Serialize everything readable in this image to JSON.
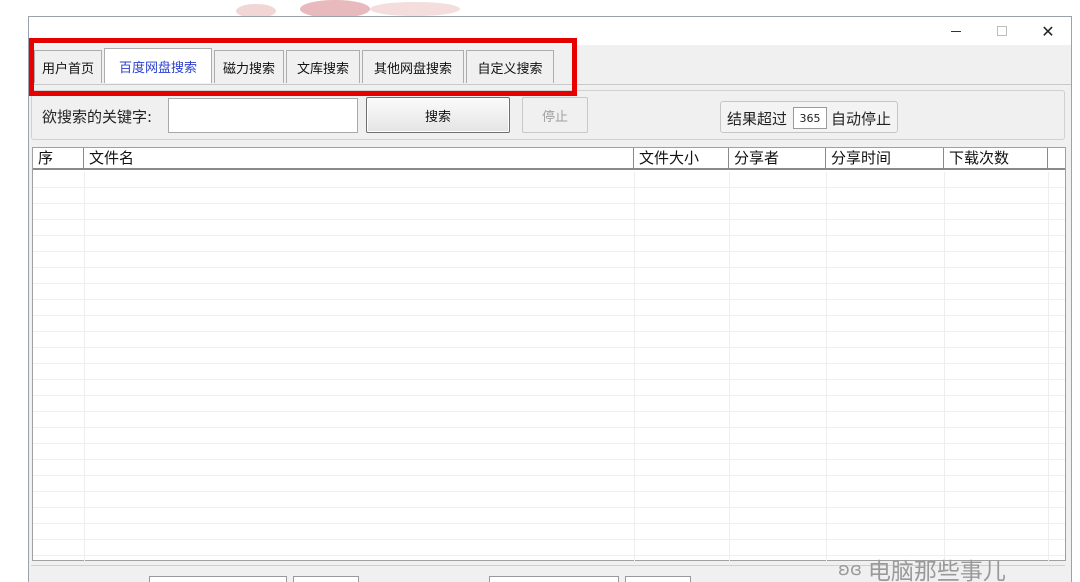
{
  "window": {
    "minimize_symbol": "—",
    "maximize_symbol": "□",
    "close_symbol": "✕"
  },
  "tabs": [
    {
      "label": "用户首页",
      "active": false
    },
    {
      "label": "百度网盘搜索",
      "active": true
    },
    {
      "label": "磁力搜索",
      "active": false
    },
    {
      "label": "文库搜索",
      "active": false
    },
    {
      "label": "其他网盘搜索",
      "active": false
    },
    {
      "label": "自定义搜索",
      "active": false
    }
  ],
  "search": {
    "label": "欲搜索的关键字:",
    "keyword_value": "",
    "search_button": "搜索",
    "stop_button": "停止",
    "limit_prefix": "结果超过",
    "limit_value": "365",
    "limit_suffix": "自动停止"
  },
  "table": {
    "columns": [
      "序",
      "文件名",
      "文件大小",
      "分享者",
      "分享时间",
      "下载次数"
    ],
    "rows": []
  },
  "watermark": {
    "text": "电脑那些事儿",
    "icon": "wechat-icon"
  },
  "colors": {
    "highlight": "#e60000",
    "active_tab_text": "#2a3fd0"
  }
}
